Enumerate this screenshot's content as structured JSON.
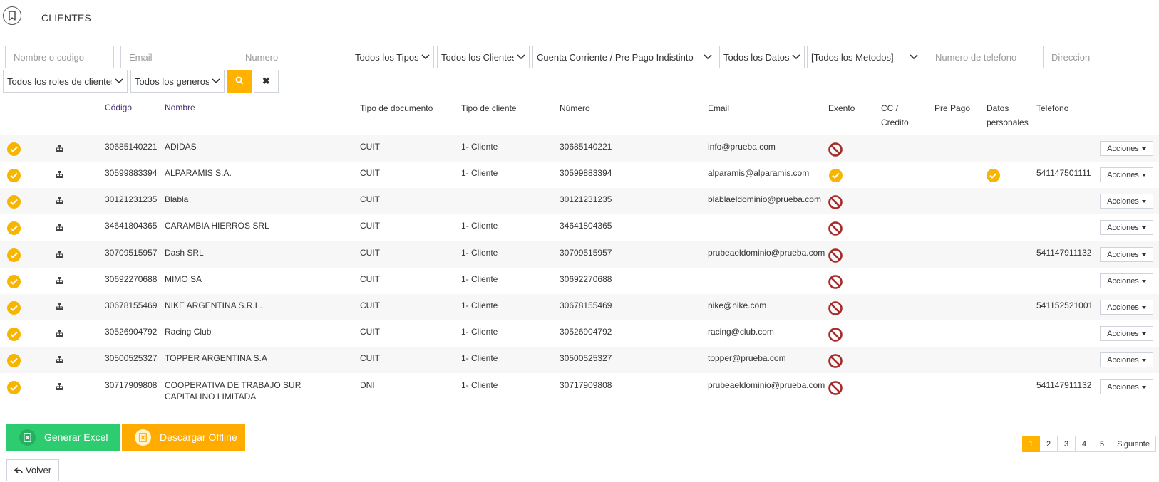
{
  "header": {
    "title": "CLIENTES",
    "icon": "bookmark-icon"
  },
  "filters": {
    "name_placeholder": "Nombre o codigo",
    "email_placeholder": "Email",
    "number_placeholder": "Numero",
    "types": "Todos los Tipos",
    "clients": "Todos los Clientes",
    "account": "Cuenta Corriente / Pre Pago Indistinto",
    "data": "Todos los Datos",
    "methods": "[Todos los Metodos]",
    "phone_placeholder": "Numero de telefono",
    "address_placeholder": "Direccion",
    "roles": "Todos los roles de clientes",
    "genders": "Todos los generos"
  },
  "columns": {
    "codigo": "Código",
    "nombre": "Nombre",
    "tipo_doc": "Tipo de documento",
    "tipo_cli": "Tipo de cliente",
    "numero": "Número",
    "email": "Email",
    "exento": "Exento",
    "cc1": "CC /",
    "cc2": "Credito",
    "prepago": "Pre Pago",
    "datos1": "Datos",
    "datos2": "personales",
    "telefono": "Telefono"
  },
  "accent_color": "#ffb300",
  "rows": [
    {
      "codigo": "30685140221",
      "nombre": "ADIDAS",
      "tipo_doc": "CUIT",
      "tipo_cli": "1- Cliente",
      "numero": "30685140221",
      "email": "info@prueba.com",
      "exento": false,
      "datos": false,
      "telefono": "",
      "acciones": "Acciones"
    },
    {
      "codigo": "30599883394",
      "nombre": "ALPARAMIS S.A.",
      "tipo_doc": "CUIT",
      "tipo_cli": "1- Cliente",
      "numero": "30599883394",
      "email": "alparamis@alparamis.com",
      "exento": true,
      "datos": true,
      "telefono": "541147501111",
      "acciones": "Acciones"
    },
    {
      "codigo": "30121231235",
      "nombre": "Blabla",
      "tipo_doc": "CUIT",
      "tipo_cli": "",
      "numero": "30121231235",
      "email": "blablaeldominio@prueba.com",
      "exento": false,
      "datos": false,
      "telefono": "",
      "acciones": "Acciones"
    },
    {
      "codigo": "34641804365",
      "nombre": "CARAMBIA HIERROS SRL",
      "tipo_doc": "CUIT",
      "tipo_cli": "1- Cliente",
      "numero": "34641804365",
      "email": "",
      "exento": false,
      "datos": false,
      "telefono": "",
      "acciones": "Acciones"
    },
    {
      "codigo": "30709515957",
      "nombre": "Dash SRL",
      "tipo_doc": "CUIT",
      "tipo_cli": "1- Cliente",
      "numero": "30709515957",
      "email": "prubeaeldominio@prueba.com",
      "exento": false,
      "datos": false,
      "telefono": "541147911132",
      "acciones": "Acciones"
    },
    {
      "codigo": "30692270688",
      "nombre": "MIMO SA",
      "tipo_doc": "CUIT",
      "tipo_cli": "1- Cliente",
      "numero": "30692270688",
      "email": "",
      "exento": false,
      "datos": false,
      "telefono": "",
      "acciones": "Acciones"
    },
    {
      "codigo": "30678155469",
      "nombre": "NIKE ARGENTINA S.R.L.",
      "tipo_doc": "CUIT",
      "tipo_cli": "1- Cliente",
      "numero": "30678155469",
      "email": "nike@nike.com",
      "exento": false,
      "datos": false,
      "telefono": "541152521001",
      "acciones": "Acciones"
    },
    {
      "codigo": "30526904792",
      "nombre": "Racing Club",
      "tipo_doc": "CUIT",
      "tipo_cli": "1- Cliente",
      "numero": "30526904792",
      "email": "racing@club.com",
      "exento": false,
      "datos": false,
      "telefono": "",
      "acciones": "Acciones"
    },
    {
      "codigo": "30500525327",
      "nombre": "TOPPER ARGENTINA S.A",
      "tipo_doc": "CUIT",
      "tipo_cli": "1- Cliente",
      "numero": "30500525327",
      "email": "topper@prueba.com",
      "exento": false,
      "datos": false,
      "telefono": "",
      "acciones": "Acciones"
    },
    {
      "codigo": "30717909808",
      "nombre": "COOPERATIVA DE TRABAJO SUR CAPITALINO LIMITADA",
      "tipo_doc": "DNI",
      "tipo_cli": "1- Cliente",
      "numero": "30717909808",
      "email": "prubeaeldominio@prueba.com",
      "exento": false,
      "datos": false,
      "telefono": "541147911132",
      "acciones": "Acciones"
    }
  ],
  "footer": {
    "excel": "Generar Excel",
    "offline": "Descargar Offline",
    "volver": "Volver"
  },
  "pagination": {
    "pages": [
      "1",
      "2",
      "3",
      "4",
      "5"
    ],
    "next": "Siguiente",
    "current": "1"
  }
}
